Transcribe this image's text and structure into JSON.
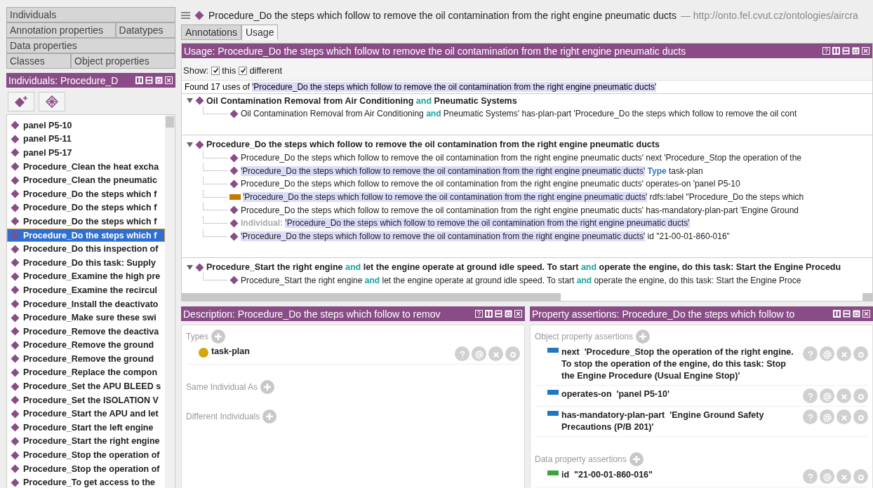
{
  "left_tabs": [
    {
      "tabs": [
        {
          "label": "Individuals"
        }
      ]
    },
    {
      "tabs": [
        {
          "label": "Annotation properties"
        },
        {
          "label": "Datatypes"
        }
      ]
    },
    {
      "tabs": [
        {
          "label": "Data properties"
        }
      ]
    },
    {
      "tabs": [
        {
          "label": "Classes"
        },
        {
          "label": "Object properties"
        }
      ]
    }
  ],
  "individuals_panel": {
    "title": "Individuals: Procedure_D",
    "items": [
      {
        "label": "panel P5-10",
        "selected": false
      },
      {
        "label": "panel P5-11",
        "selected": false
      },
      {
        "label": "panel P5-17",
        "selected": false
      },
      {
        "label": "Procedure_Clean the heat excha",
        "selected": false
      },
      {
        "label": "Procedure_Clean the pneumatic",
        "selected": false
      },
      {
        "label": "Procedure_Do the steps which f",
        "selected": false
      },
      {
        "label": "Procedure_Do the steps which f",
        "selected": false
      },
      {
        "label": "Procedure_Do the steps which f",
        "selected": false
      },
      {
        "label": "Procedure_Do the steps which f",
        "selected": true
      },
      {
        "label": "Procedure_Do this inspection of",
        "selected": false
      },
      {
        "label": "Procedure_Do this task: Supply",
        "selected": false
      },
      {
        "label": "Procedure_Examine the high pre",
        "selected": false
      },
      {
        "label": "Procedure_Examine the recircul",
        "selected": false
      },
      {
        "label": "Procedure_Install the deactivato",
        "selected": false
      },
      {
        "label": "Procedure_Make sure these swi",
        "selected": false
      },
      {
        "label": "Procedure_Remove the deactiva",
        "selected": false
      },
      {
        "label": "Procedure_Remove the ground",
        "selected": false
      },
      {
        "label": "Procedure_Remove the ground",
        "selected": false
      },
      {
        "label": "Procedure_Replace the compon",
        "selected": false
      },
      {
        "label": "Procedure_Set the APU BLEED s",
        "selected": false
      },
      {
        "label": "Procedure_Set the ISOLATION V",
        "selected": false
      },
      {
        "label": "Procedure_Start the APU and let",
        "selected": false
      },
      {
        "label": "Procedure_Start the left engine",
        "selected": false
      },
      {
        "label": "Procedure_Start the right engine",
        "selected": false
      },
      {
        "label": "Procedure_Stop the operation of",
        "selected": false
      },
      {
        "label": "Procedure_Stop the operation of",
        "selected": false
      },
      {
        "label": "Procedure_To get access to the",
        "selected": false
      }
    ]
  },
  "entity_bar": {
    "title": "Procedure_Do the steps which follow to remove the oil contamination from the right engine pneumatic ducts",
    "iri": "— http://onto.fel.cvut.cz/ontologies/aircra"
  },
  "tabs": [
    {
      "label": "Annotations",
      "selected": false
    },
    {
      "label": "Usage",
      "selected": true
    }
  ],
  "usage": {
    "title": "Usage: Procedure_Do the steps which follow to remove the oil contamination from the right engine pneumatic ducts",
    "show_label": "Show:",
    "options": [
      {
        "label": "this",
        "checked": true
      },
      {
        "label": "different",
        "checked": true
      }
    ],
    "found": [
      {
        "kind": "plain",
        "text": "Found 17 uses of "
      },
      {
        "kind": "quoted",
        "text": "'Procedure_Do the steps which follow to remove the oil contamination from the right engine pneumatic ducts'"
      }
    ],
    "groups": [
      {
        "expanded": true,
        "heading": [
          {
            "kind": "plain",
            "text": "Oil Contamination Removal from Air Conditioning "
          },
          {
            "kind": "keyword",
            "text": "and"
          },
          {
            "kind": "plain",
            "text": " Pneumatic Systems"
          }
        ],
        "lines": [
          {
            "kind": "individual",
            "segments": [
              {
                "kind": "plain",
                "text": "Oil Contamination Removal from Air Conditioning "
              },
              {
                "kind": "keyword",
                "text": "and"
              },
              {
                "kind": "plain",
                "text": " Pneumatic Systems' has-plan-part 'Procedure_Do the steps which follow to remove the oil cont"
              }
            ]
          }
        ]
      },
      {
        "expanded": true,
        "heading": [
          {
            "kind": "plain",
            "text": "Procedure_Do the steps which follow to remove the oil contamination from the right engine pneumatic ducts"
          }
        ],
        "lines": [
          {
            "kind": "individual",
            "segments": [
              {
                "kind": "plain",
                "text": "Procedure_Do the steps which follow to remove the oil contamination from the right engine pneumatic ducts' next 'Procedure_Stop the operation of the"
              }
            ]
          },
          {
            "kind": "individual",
            "segments": [
              {
                "kind": "quoted",
                "text": "'Procedure_Do the steps which follow to remove the oil contamination from the right engine pneumatic ducts'"
              },
              {
                "kind": "type",
                "text": " Type"
              },
              {
                "kind": "plain",
                "text": " task-plan"
              }
            ]
          },
          {
            "kind": "individual",
            "segments": [
              {
                "kind": "plain",
                "text": "Procedure_Do the steps which follow to remove the oil contamination from the right engine pneumatic ducts' operates-on 'panel P5-10"
              }
            ]
          },
          {
            "kind": "annotation",
            "segments": [
              {
                "kind": "quoted",
                "text": "'Procedure_Do the steps which follow to remove the oil contamination from the right engine pneumatic ducts'"
              },
              {
                "kind": "plain",
                "text": " rdfs:label \"Procedure_Do the steps which"
              }
            ]
          },
          {
            "kind": "individual",
            "segments": [
              {
                "kind": "plain",
                "text": "Procedure_Do the steps which follow to remove the oil contamination from the right engine pneumatic ducts' has-mandatory-plan-part 'Engine Ground"
              }
            ]
          },
          {
            "kind": "individual",
            "segments": [
              {
                "kind": "muted",
                "text": "Individual: "
              },
              {
                "kind": "quoted",
                "text": "'Procedure_Do the steps which follow to remove the oil contamination from the right engine pneumatic ducts'"
              }
            ]
          },
          {
            "kind": "individual",
            "segments": [
              {
                "kind": "quoted",
                "text": "'Procedure_Do the steps which follow to remove the oil contamination from the right engine pneumatic ducts'"
              },
              {
                "kind": "plain",
                "text": " id \"21-00-01-860-016\""
              }
            ]
          }
        ]
      },
      {
        "expanded": true,
        "heading": [
          {
            "kind": "plain",
            "text": "Procedure_Start the right engine "
          },
          {
            "kind": "keyword",
            "text": "and"
          },
          {
            "kind": "plain",
            "text": " let the engine operate at ground idle speed. To start "
          },
          {
            "kind": "keyword",
            "text": "and"
          },
          {
            "kind": "plain",
            "text": " operate the engine, do this task: Start the Engine Procedu"
          }
        ],
        "lines": [
          {
            "kind": "individual",
            "segments": [
              {
                "kind": "plain",
                "text": "Procedure_Start the right engine "
              },
              {
                "kind": "keyword",
                "text": "and"
              },
              {
                "kind": "plain",
                "text": " let the engine operate at ground idle speed. To start "
              },
              {
                "kind": "keyword",
                "text": "and"
              },
              {
                "kind": "plain",
                "text": " operate the engine, do this task: Start the Engine Proce"
              }
            ]
          }
        ]
      }
    ]
  },
  "description": {
    "title": "Description: Procedure_Do the steps which follow to remov",
    "sections": [
      {
        "label": "Types",
        "items": [
          {
            "label": "task-plan"
          }
        ]
      },
      {
        "label": "Same Individual As"
      },
      {
        "label": "Different Individuals"
      }
    ]
  },
  "property_assertions": {
    "title": "Property assertions: Procedure_Do the steps which follow to",
    "sections": [
      {
        "label": "Object property assertions",
        "kind": "object",
        "items": [
          {
            "property": "next",
            "value": "'Procedure_Stop the operation of the right engine. To stop the operation of the engine, do this task: Stop the Engine Procedure (Usual Engine Stop)'"
          },
          {
            "property": "operates-on",
            "value": "'panel P5-10'"
          },
          {
            "property": "has-mandatory-plan-part",
            "value": "'Engine Ground Safety Precautions (P/B 201)'"
          }
        ]
      },
      {
        "label": "Data property assertions",
        "kind": "data",
        "items": [
          {
            "property": "id",
            "value": "\"21-00-01-860-016\""
          }
        ]
      }
    ]
  }
}
